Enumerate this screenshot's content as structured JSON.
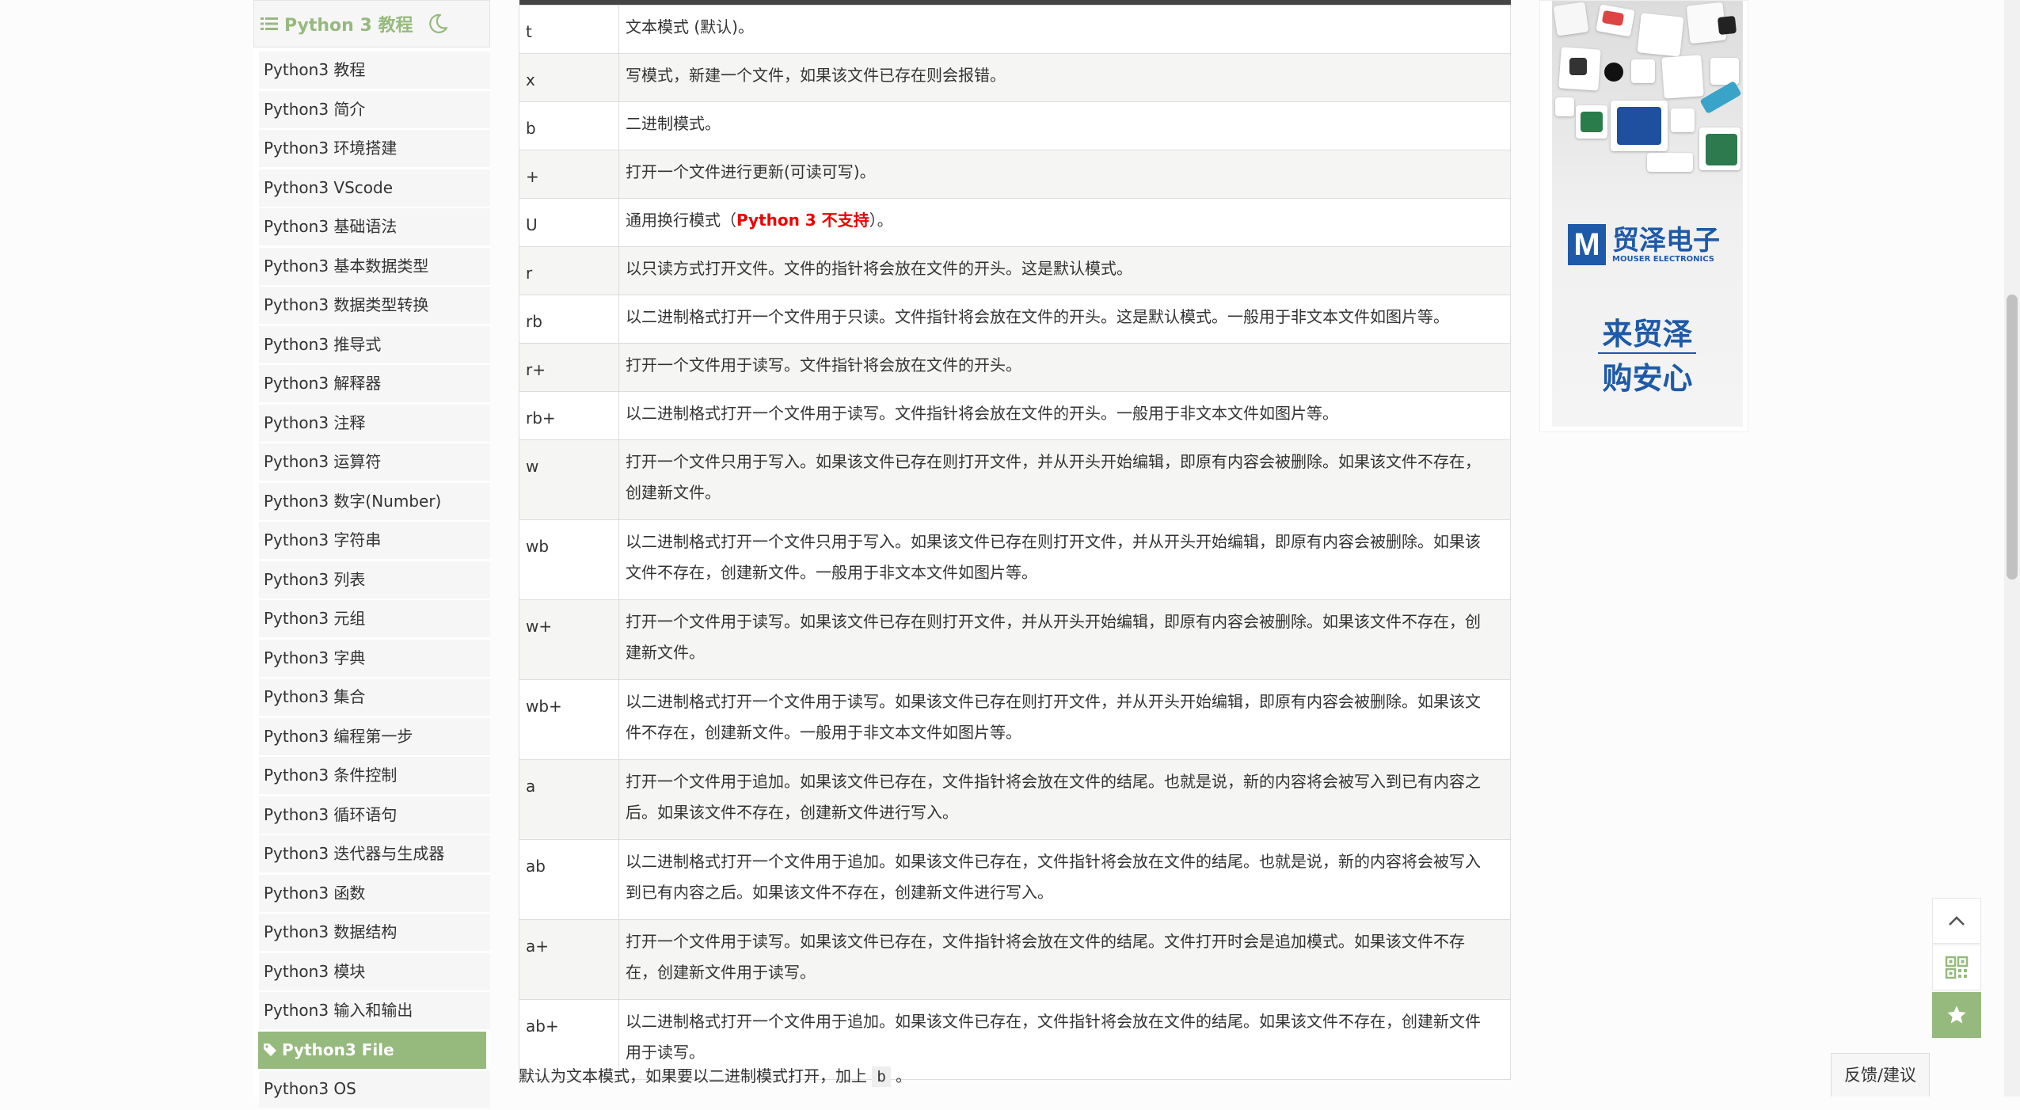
{
  "sidebar": {
    "title": "Python 3 教程",
    "items": [
      "Python3 教程",
      "Python3 简介",
      "Python3 环境搭建",
      "Python3 VScode",
      "Python3 基础语法",
      "Python3 基本数据类型",
      "Python3 数据类型转换",
      "Python3 推导式",
      "Python3 解释器",
      "Python3 注释",
      "Python3 运算符",
      "Python3 数字(Number)",
      "Python3 字符串",
      "Python3 列表",
      "Python3 元组",
      "Python3 字典",
      "Python3 集合",
      "Python3 编程第一步",
      "Python3 条件控制",
      "Python3 循环语句",
      "Python3 迭代器与生成器",
      "Python3 函数",
      "Python3 数据结构",
      "Python3 模块",
      "Python3 输入和输出"
    ],
    "active_item": "Python3 File",
    "next_item": "Python3 OS"
  },
  "table": {
    "rows": [
      {
        "mode": "t",
        "desc": "文本模式 (默认)。"
      },
      {
        "mode": "x",
        "desc": "写模式，新建一个文件，如果该文件已存在则会报错。"
      },
      {
        "mode": "b",
        "desc": "二进制模式。"
      },
      {
        "mode": "+",
        "desc": "打开一个文件进行更新(可读可写)。"
      },
      {
        "mode": "U",
        "desc_pre": "通用换行模式（",
        "desc_red": "Python 3 不支持",
        "desc_post": "）。"
      },
      {
        "mode": "r",
        "desc": "以只读方式打开文件。文件的指针将会放在文件的开头。这是默认模式。"
      },
      {
        "mode": "rb",
        "desc": "以二进制格式打开一个文件用于只读。文件指针将会放在文件的开头。这是默认模式。一般用于非文本文件如图片等。"
      },
      {
        "mode": "r+",
        "desc": "打开一个文件用于读写。文件指针将会放在文件的开头。"
      },
      {
        "mode": "rb+",
        "desc": "以二进制格式打开一个文件用于读写。文件指针将会放在文件的开头。一般用于非文本文件如图片等。"
      },
      {
        "mode": "w",
        "desc": "打开一个文件只用于写入。如果该文件已存在则打开文件，并从开头开始编辑，即原有内容会被删除。如果该文件不存在，创建新文件。"
      },
      {
        "mode": "wb",
        "desc": "以二进制格式打开一个文件只用于写入。如果该文件已存在则打开文件，并从开头开始编辑，即原有内容会被删除。如果该文件不存在，创建新文件。一般用于非文本文件如图片等。"
      },
      {
        "mode": "w+",
        "desc": "打开一个文件用于读写。如果该文件已存在则打开文件，并从开头开始编辑，即原有内容会被删除。如果该文件不存在，创建新文件。"
      },
      {
        "mode": "wb+",
        "desc": "以二进制格式打开一个文件用于读写。如果该文件已存在则打开文件，并从开头开始编辑，即原有内容会被删除。如果该文件不存在，创建新文件。一般用于非文本文件如图片等。"
      },
      {
        "mode": "a",
        "desc": "打开一个文件用于追加。如果该文件已存在，文件指针将会放在文件的结尾。也就是说，新的内容将会被写入到已有内容之后。如果该文件不存在，创建新文件进行写入。"
      },
      {
        "mode": "ab",
        "desc": "以二进制格式打开一个文件用于追加。如果该文件已存在，文件指针将会放在文件的结尾。也就是说，新的内容将会被写入到已有内容之后。如果该文件不存在，创建新文件进行写入。"
      },
      {
        "mode": "a+",
        "desc": "打开一个文件用于读写。如果该文件已存在，文件指针将会放在文件的结尾。文件打开时会是追加模式。如果该文件不存在，创建新文件用于读写。"
      },
      {
        "mode": "ab+",
        "desc": "以二进制格式打开一个文件用于追加。如果该文件已存在，文件指针将会放在文件的结尾。如果该文件不存在，创建新文件用于读写。"
      }
    ]
  },
  "note": {
    "pre": "默认为文本模式，如果要以二进制模式打开，加上 ",
    "code": "b",
    "post": " 。"
  },
  "ad": {
    "brand_cn": "贸泽电子",
    "brand_en": "MOUSER ELECTRONICS",
    "slogan_line1": "来贸泽",
    "slogan_line2": "购安心"
  },
  "tools": {
    "feedback": "反馈/建议"
  },
  "colors": {
    "accent": "#96b97d",
    "red": "#ee0000",
    "brand_blue": "#1e5aa8"
  }
}
